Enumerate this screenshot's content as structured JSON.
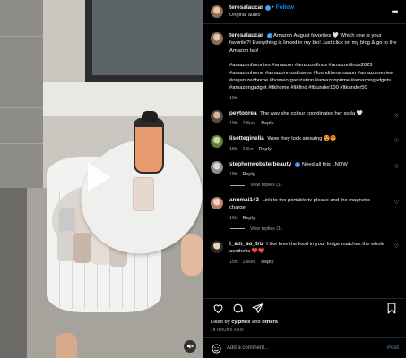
{
  "header": {
    "username": "teresalaucar",
    "separator": "•",
    "follow_label": "Follow",
    "subline": "Original audio",
    "more_icon": "more-horizontal-icon"
  },
  "caption": {
    "username": "teresalaucar",
    "text": "Amazon August favorites 🤍 Which one is your favorite?! Everything is linked in my bio! Just click on my blog & go to the Amazon tab!",
    "hashtags": "#amazonfavorites #amazon #amazonfinds #amazonfinds2023 #amazonhome #amazonmusthaves #founditonamazon #amazonreview #organizedhome #homeorganization #amazonprime #amazongadgets #amazongadget #ltkhome #ltkfind #ltkunder100 #ltkunder50",
    "time": "19h"
  },
  "comments": [
    {
      "username": "peytonrea",
      "text": "The way she colour coordinates her soda 🤍",
      "time": "19h",
      "likes": "2 likes",
      "reply": "Reply",
      "view_replies": ""
    },
    {
      "username": "lisetteginella",
      "text": "Wow they look amazing 😍😍",
      "time": "18h",
      "likes": "1 like",
      "reply": "Reply",
      "view_replies": ""
    },
    {
      "username": "stephenwebsterbeauty",
      "text": "Need all this ..NOW",
      "time": "18h",
      "likes": "",
      "reply": "Reply",
      "view_replies": "View replies (1)"
    },
    {
      "username": "annmai143",
      "text": "Link to the portable tv please and the magnetic charger",
      "time": "16h",
      "likes": "",
      "reply": "Reply",
      "view_replies": "View replies (1)"
    },
    {
      "username": "i_am_so_tru",
      "text": "I like love the food in your fridge matches the whole aesthetic ❤️❤️",
      "time": "15h",
      "likes": "2 likes",
      "reply": "Reply",
      "view_replies": ""
    }
  ],
  "engagement": {
    "liked_by_prefix": "Liked by ",
    "liked_by_user": "cy.phex",
    "liked_by_suffix_and": " and ",
    "liked_by_others": "others",
    "date": "19 HOURS AGO"
  },
  "composer": {
    "placeholder": "Add a comment...",
    "post_label": "Post"
  },
  "colors": {
    "accent": "#0095f6",
    "background": "#000000",
    "secondary_text": "#a8a8a8"
  }
}
